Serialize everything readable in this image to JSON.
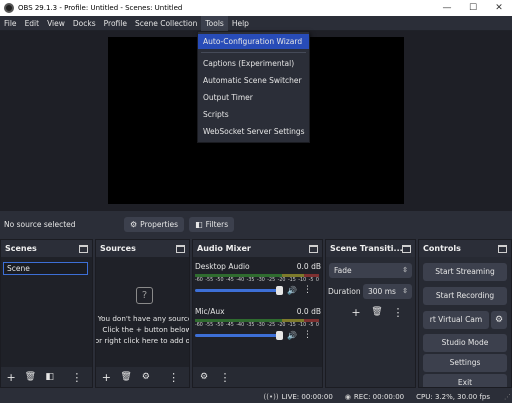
{
  "window": {
    "title": "OBS 29.1.3 - Profile: Untitled - Scenes: Untitled",
    "minimize": "—",
    "maximize": "☐",
    "close": "✕"
  },
  "menubar": {
    "items": [
      "File",
      "Edit",
      "View",
      "Docks",
      "Profile",
      "Scene Collection",
      "Tools",
      "Help"
    ],
    "active": "Tools"
  },
  "tools_menu": {
    "items": [
      "Auto-Configuration Wizard",
      "Captions (Experimental)",
      "Automatic Scene Switcher",
      "Output Timer",
      "Scripts",
      "WebSocket Server Settings"
    ],
    "highlighted": "Auto-Configuration Wizard"
  },
  "source_toolbar": {
    "status": "No source selected",
    "properties_label": "Properties",
    "filters_label": "Filters"
  },
  "docks": {
    "scenes": {
      "title": "Scenes",
      "items": [
        "Scene"
      ]
    },
    "sources": {
      "title": "Sources",
      "empty_lines": [
        "You don't have any sources.",
        "Click the + button below,",
        "or right click here to add one."
      ]
    },
    "mixer": {
      "title": "Audio Mixer",
      "ticks": [
        "-60",
        "-55",
        "-50",
        "-45",
        "-40",
        "-35",
        "-30",
        "-25",
        "-20",
        "-15",
        "-10",
        "-5",
        "0"
      ],
      "channels": [
        {
          "name": "Desktop Audio",
          "level": "0.0 dB",
          "volume": 1.0
        },
        {
          "name": "Mic/Aux",
          "level": "0.0 dB",
          "volume": 1.0
        }
      ]
    },
    "transitions": {
      "title": "Scene Transiti...",
      "transition": "Fade",
      "duration_label": "Duration",
      "duration_value": "300 ms"
    },
    "controls": {
      "title": "Controls",
      "buttons": [
        "Start Streaming",
        "Start Recording",
        "rt Virtual Cam",
        "Studio Mode",
        "Settings",
        "Exit"
      ]
    }
  },
  "statusbar": {
    "live": "LIVE: 00:00:00",
    "rec": "REC: 00:00:00",
    "cpu": "CPU: 3.2%, 30.00 fps"
  },
  "colors": {
    "accent": "#284cb8",
    "panel_bg": "#272a33",
    "window_bg": "#2b2e38"
  }
}
